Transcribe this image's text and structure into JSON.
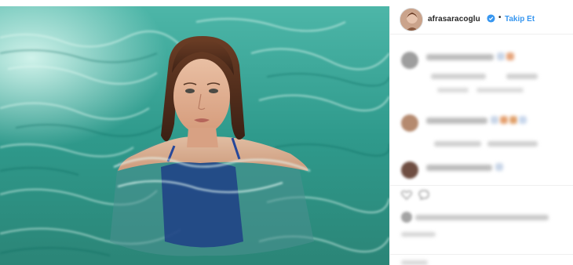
{
  "post": {
    "username": "afrasaracoglu",
    "separator": "•",
    "follow_label": "Takip Et"
  },
  "colors": {
    "follow_blue": "#3897f0",
    "verified_blue": "#3897f0",
    "water": "#3aa69a",
    "swimsuit": "#1f3f86"
  },
  "icons": {
    "verified": "verified-badge-icon",
    "like": "heart-icon",
    "comment": "comment-bubble-icon"
  },
  "comments": [
    {
      "username": "",
      "text": "",
      "meta": ""
    },
    {
      "username": "",
      "text": "",
      "meta": ""
    },
    {
      "username": "",
      "text": "",
      "meta": ""
    }
  ]
}
